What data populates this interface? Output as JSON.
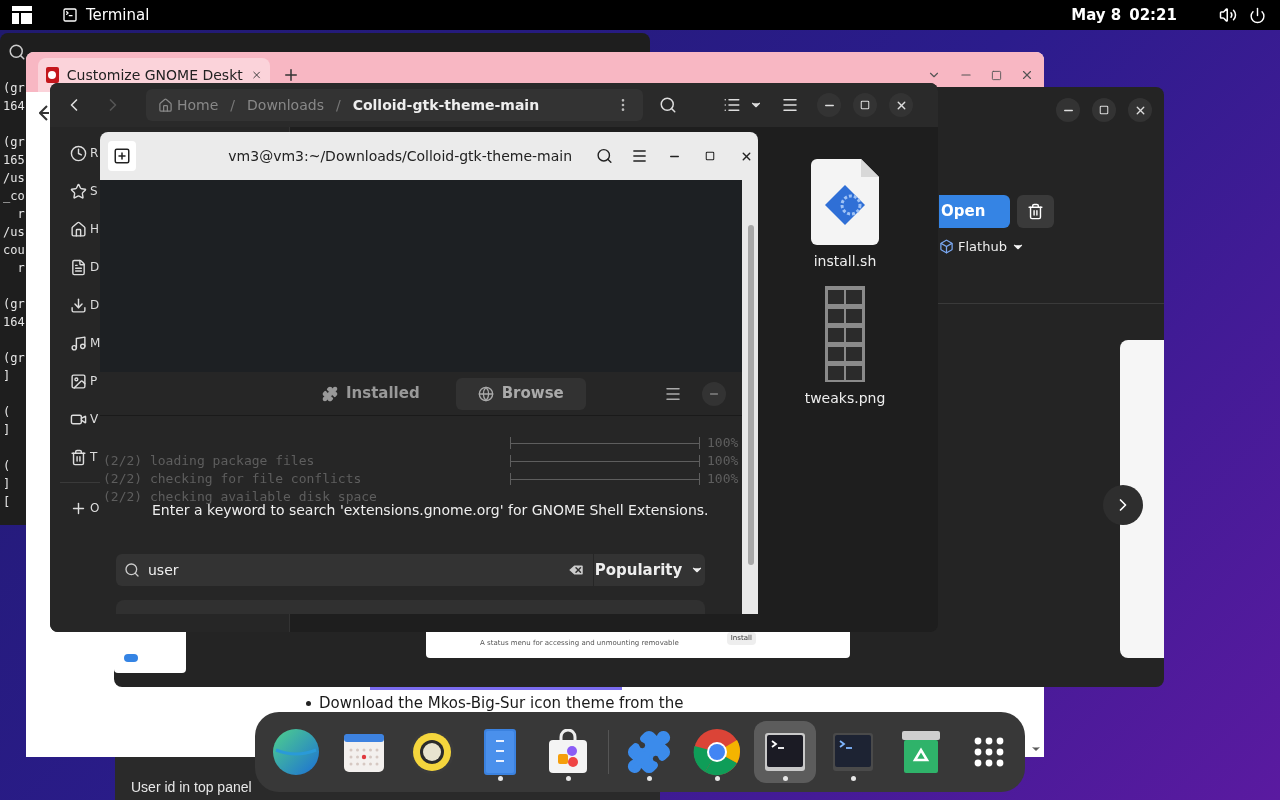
{
  "top_bar": {
    "app_name": "Terminal",
    "date": "May 8",
    "time": "02:21"
  },
  "background_terminal": {
    "blocks": [
      [
        "(gr",
        "164"
      ],
      [
        "(gr",
        "165",
        "/us",
        "_co",
        "  r",
        "/us",
        "cou",
        "  r"
      ],
      [
        "(gr",
        "164"
      ],
      [
        "(gr",
        "]"
      ],
      [
        "(",
        "]"
      ],
      [
        "(",
        "]",
        "["
      ]
    ]
  },
  "browser": {
    "tab": {
      "title": "Customize GNOME Deskt"
    },
    "bullet": "Download the Mkos-Big-Sur icon theme from the"
  },
  "lower_window": {
    "text": "User id in top panel"
  },
  "software": {
    "open_label": "Open",
    "source": "Flathub",
    "card_text": "A status menu for accessing and unmounting removable",
    "install_label": "Install"
  },
  "files": {
    "back": {
      "disabled": false
    },
    "forward": {
      "disabled": true
    },
    "breadcrumb": [
      {
        "label": "Home",
        "kind": "home",
        "current": false
      },
      {
        "separator": "/",
        "label": "Downloads",
        "kind": "folder",
        "current": false
      },
      {
        "separator": "/",
        "label": "Colloid-gtk-theme-main",
        "kind": "folder",
        "current": true
      }
    ],
    "sidebar": [
      {
        "label": "R",
        "kind": "recent"
      },
      {
        "label": "S",
        "kind": "starred"
      },
      {
        "label": "H",
        "kind": "home"
      },
      {
        "label": "D",
        "kind": "documents"
      },
      {
        "label": "D",
        "kind": "downloads"
      },
      {
        "label": "M",
        "kind": "music"
      },
      {
        "label": "P",
        "kind": "pictures"
      },
      {
        "label": "V",
        "kind": "videos"
      },
      {
        "label": "T",
        "kind": "trash"
      }
    ],
    "sidebar_other": {
      "label": "O",
      "kind": "other"
    },
    "items": [
      {
        "name": "install.sh",
        "kind": "script"
      },
      {
        "name": "tweaks.png",
        "kind": "image"
      }
    ]
  },
  "terminal": {
    "title": "vm3@vm3:~/Downloads/Colloid-gtk-theme-main",
    "rows": [
      {
        "level": 1,
        "percent": "100%"
      },
      {
        "text": "(2/2) loading package files",
        "level": 1,
        "percent": "100%"
      },
      {
        "text": "(2/2) checking for file conflicts",
        "level": 1,
        "percent": "100%"
      },
      {
        "text": "(2/2) checking available disk space"
      }
    ]
  },
  "extensions": {
    "tabs": [
      {
        "label": "Installed",
        "kind": "puzzle",
        "selected": false
      },
      {
        "label": "Browse",
        "kind": "globe",
        "selected": true
      }
    ],
    "hint": "Enter a keyword to search 'extensions.gnome.org' for GNOME Shell Extensions.",
    "search": {
      "value": "user"
    },
    "sort": "Popularity"
  },
  "dock": {
    "pinned": [
      {
        "kind": "globe",
        "running": false,
        "selected": false
      },
      {
        "kind": "calendar",
        "running": false,
        "selected": false
      },
      {
        "kind": "speaker",
        "running": false,
        "selected": false
      },
      {
        "kind": "files",
        "running": true,
        "selected": false
      },
      {
        "kind": "store",
        "running": true,
        "selected": false
      }
    ],
    "others": [
      {
        "kind": "puzzle",
        "running": true,
        "selected": false
      },
      {
        "kind": "chrome",
        "running": true,
        "selected": false
      },
      {
        "kind": "terminal",
        "running": true,
        "selected": true
      },
      {
        "kind": "console",
        "running": true,
        "selected": false
      },
      {
        "kind": "recycle",
        "running": false,
        "selected": false
      }
    ]
  }
}
